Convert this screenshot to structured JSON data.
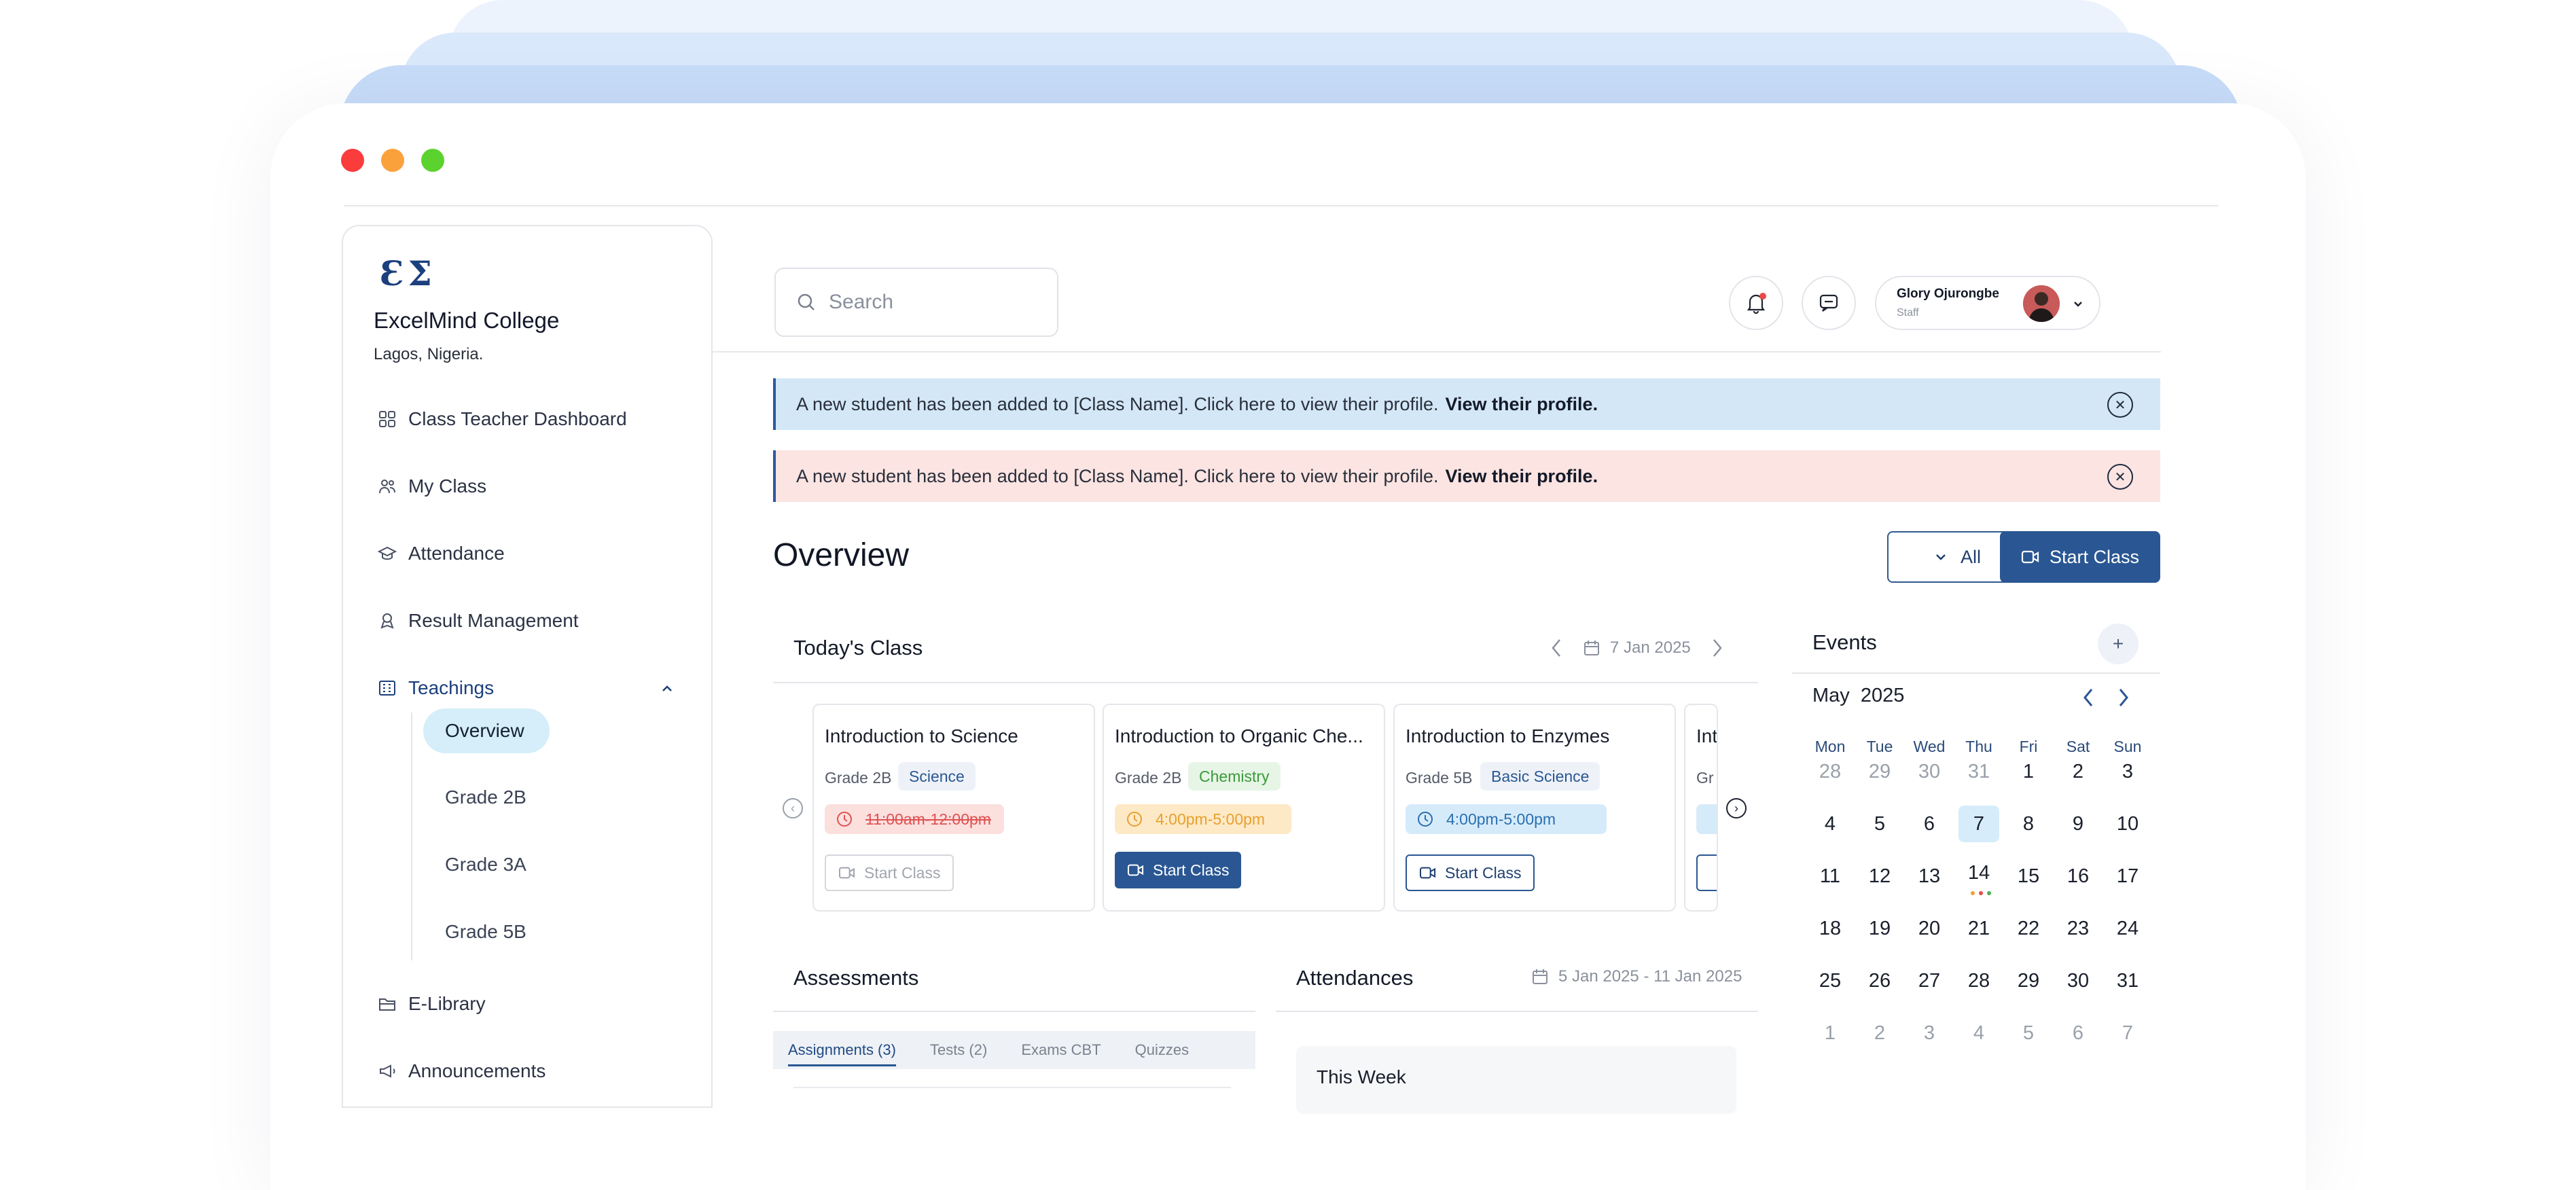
{
  "window": {
    "controls": {
      "close_color": "#fb3c3c",
      "minimize_color": "#fba13c",
      "maximize_color": "#5bd22e"
    }
  },
  "sidebar": {
    "logo": "Ɛ Σ",
    "college_name": "ExcelMind College",
    "location": "Lagos, Nigeria.",
    "items": [
      {
        "label": "Class Teacher Dashboard",
        "icon": "grid-icon"
      },
      {
        "label": "My Class",
        "icon": "users-icon"
      },
      {
        "label": "Attendance",
        "icon": "graduation-cap-icon"
      },
      {
        "label": "Result Management",
        "icon": "user-award-icon"
      },
      {
        "label": "Teachings",
        "icon": "building-icon"
      },
      {
        "label": "E-Library",
        "icon": "folder-icon"
      },
      {
        "label": "Announcements",
        "icon": "megaphone-icon"
      }
    ],
    "sub_items": [
      "Overview",
      "Grade 2B",
      "Grade 3A",
      "Grade 5B"
    ]
  },
  "header": {
    "search_placeholder": "Search",
    "user_name": "Glory Ojurongbe",
    "user_role": "Staff"
  },
  "banners": [
    {
      "text": "A new student has been added to [Class Name]. Click here to view their profile.",
      "link": "View their profile.",
      "color": "#d3e7f7"
    },
    {
      "text": "A new student has been added to [Class Name]. Click here to view their profile.",
      "link": "View their profile.",
      "color": "#fbe4e2"
    }
  ],
  "overview": {
    "title": "Overview",
    "filter_label": "All",
    "start_class_label": "Start Class"
  },
  "todays_class": {
    "title": "Today's Class",
    "date": "7 Jan 2025",
    "cards": [
      {
        "title": "Introduction to Science",
        "grade": "Grade 2B",
        "subject": "Science",
        "time": "11:00am-12:00pm",
        "button": "Start Class"
      },
      {
        "title": "Introduction to Organic Che...",
        "grade": "Grade 2B",
        "subject": "Chemistry",
        "time": "4:00pm-5:00pm",
        "button": "Start Class"
      },
      {
        "title": "Introduction to Enzymes",
        "grade": "Grade 5B",
        "subject": "Basic Science",
        "time": "4:00pm-5:00pm",
        "button": "Start Class"
      },
      {
        "title": "Int",
        "grade": "Gr",
        "subject": "",
        "time": "",
        "button": ""
      }
    ]
  },
  "assessments": {
    "title": "Assessments",
    "tabs": [
      "Assignments (3)",
      "Tests (2)",
      "Exams CBT",
      "Quizzes"
    ]
  },
  "attendances": {
    "title": "Attendances",
    "range": "5 Jan 2025 - 11 Jan 2025",
    "this_week": "This Week"
  },
  "events": {
    "title": "Events",
    "add": "+",
    "month": "May",
    "year": "2025",
    "days_of_week": [
      "Mon",
      "Tue",
      "Wed",
      "Thu",
      "Fri",
      "Sat",
      "Sun"
    ],
    "weeks": [
      [
        "28",
        "29",
        "30",
        "31",
        "1",
        "2",
        "3"
      ],
      [
        "4",
        "5",
        "6",
        "7",
        "8",
        "9",
        "10"
      ],
      [
        "11",
        "12",
        "13",
        "14",
        "15",
        "16",
        "17"
      ],
      [
        "18",
        "19",
        "20",
        "21",
        "22",
        "23",
        "24"
      ],
      [
        "25",
        "26",
        "27",
        "28",
        "29",
        "30",
        "31"
      ],
      [
        "1",
        "2",
        "3",
        "4",
        "5",
        "6",
        "7"
      ]
    ],
    "selected_day": "7",
    "event_day": "14",
    "event_dot_colors": [
      "#f0a030",
      "#e84a4a",
      "#4cb050"
    ]
  }
}
